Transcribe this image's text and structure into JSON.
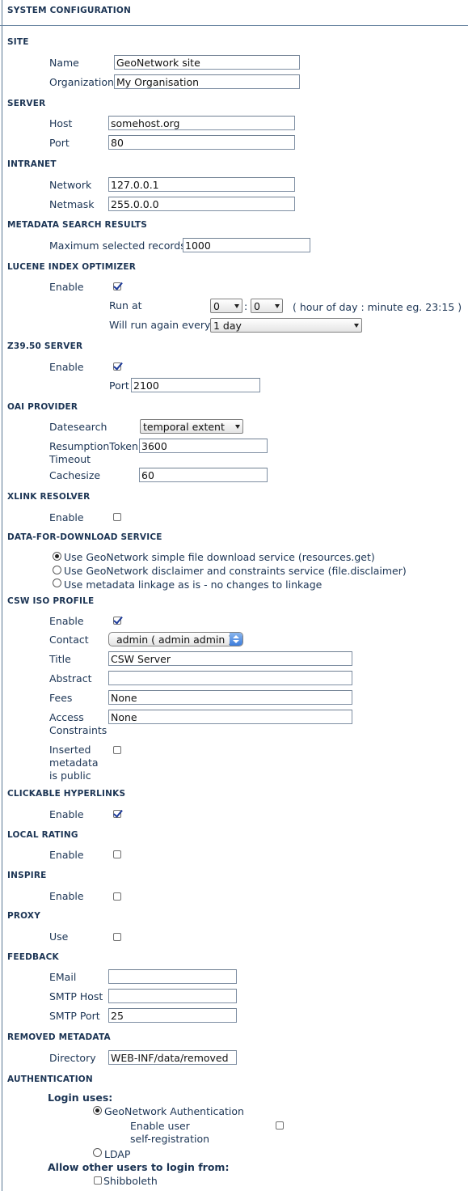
{
  "page_title": "SYSTEM CONFIGURATION",
  "site": {
    "heading": "SITE",
    "name_label": "Name",
    "name_value": "GeoNetwork site",
    "org_label": "Organization",
    "org_value": "My Organisation"
  },
  "server": {
    "heading": "SERVER",
    "host_label": "Host",
    "host_value": "somehost.org",
    "port_label": "Port",
    "port_value": "80"
  },
  "intranet": {
    "heading": "INTRANET",
    "network_label": "Network",
    "network_value": "127.0.0.1",
    "netmask_label": "Netmask",
    "netmask_value": "255.0.0.0"
  },
  "search_results": {
    "heading": "METADATA SEARCH RESULTS",
    "max_label": "Maximum selected records",
    "max_value": "1000"
  },
  "lucene": {
    "heading": "LUCENE INDEX OPTIMIZER",
    "enable_label": "Enable",
    "enabled": true,
    "run_at_label": "Run at",
    "hour": "0",
    "separator": ":",
    "minute": "0",
    "hint": "( hour of day : minute eg. 23:15 )",
    "interval_label": "Will run again every",
    "interval_value": "1 day"
  },
  "z3950": {
    "heading": "Z39.50 SERVER",
    "enable_label": "Enable",
    "enabled": true,
    "port_label": "Port",
    "port_value": "2100"
  },
  "oai": {
    "heading": "OAI PROVIDER",
    "datesearch_label": "Datesearch",
    "datesearch_value": "temporal extent",
    "token_label_1": "ResumptionToken",
    "token_label_2": "Timeout",
    "token_value": "3600",
    "cache_label": "Cachesize",
    "cache_value": "60"
  },
  "xlink": {
    "heading": "XLINK RESOLVER",
    "enable_label": "Enable",
    "enabled": false
  },
  "download": {
    "heading": "DATA-FOR-DOWNLOAD SERVICE",
    "options": [
      {
        "label": "Use GeoNetwork simple file download service (resources.get)",
        "selected": true
      },
      {
        "label": "Use GeoNetwork disclaimer and constraints service (file.disclaimer)",
        "selected": false
      },
      {
        "label": "Use metadata linkage as is - no changes to linkage",
        "selected": false
      }
    ]
  },
  "csw": {
    "heading": "CSW ISO PROFILE",
    "enable_label": "Enable",
    "enabled": true,
    "contact_label": "Contact",
    "contact_value": "admin ( admin admin )",
    "title_label": "Title",
    "title_value": "CSW Server",
    "abstract_label": "Abstract",
    "abstract_value": "",
    "fees_label": "Fees",
    "fees_value": "None",
    "access_label_1": "Access",
    "access_label_2": "Constraints",
    "access_value": "None",
    "public_label_1": "Inserted",
    "public_label_2": "metadata",
    "public_label_3": "is public",
    "public_checked": false
  },
  "hyperlinks": {
    "heading": "CLICKABLE HYPERLINKS",
    "enable_label": "Enable",
    "enabled": true
  },
  "rating": {
    "heading": "LOCAL RATING",
    "enable_label": "Enable",
    "enabled": false
  },
  "inspire": {
    "heading": "INSPIRE",
    "enable_label": "Enable",
    "enabled": false
  },
  "proxy": {
    "heading": "PROXY",
    "use_label": "Use",
    "enabled": false
  },
  "feedback": {
    "heading": "FEEDBACK",
    "email_label": "EMail",
    "email_value": "",
    "smtp_host_label": "SMTP Host",
    "smtp_host_value": "",
    "smtp_port_label": "SMTP Port",
    "smtp_port_value": "25"
  },
  "removed": {
    "heading": "REMOVED METADATA",
    "dir_label": "Directory",
    "dir_value": "WEB-INF/data/removed"
  },
  "auth": {
    "heading": "AUTHENTICATION",
    "login_uses": "Login uses:",
    "geonetwork_label": "GeoNetwork Authentication",
    "geonetwork_selected": true,
    "selfreg_label_1": "Enable user",
    "selfreg_label_2": "self-registration",
    "selfreg_checked": false,
    "ldap_label": "LDAP",
    "ldap_selected": false,
    "allow_other": "Allow other users to login from:",
    "shibboleth_label": "Shibboleth",
    "shibboleth_checked": false
  }
}
